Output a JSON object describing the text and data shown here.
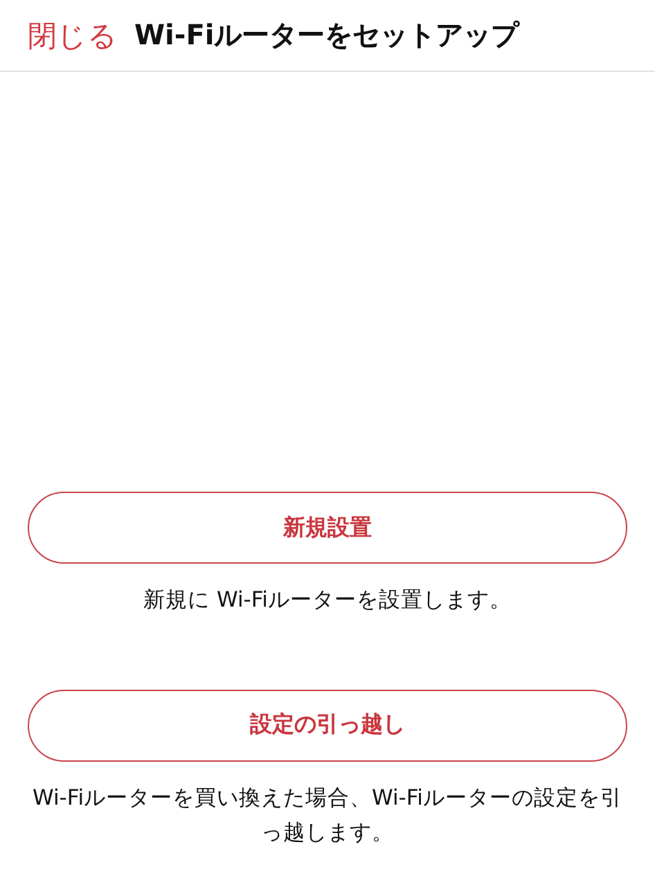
{
  "header": {
    "close": "閉じる",
    "title": "Wi-Fiルーターをセットアップ"
  },
  "options": [
    {
      "button": "新規設置",
      "description": "新規に Wi-Fiルーターを設置します。"
    },
    {
      "button": "設定の引っ越し",
      "description": "Wi-Fiルーターを買い換えた場合、Wi-Fiルーターの設定を引っ越します。"
    }
  ]
}
